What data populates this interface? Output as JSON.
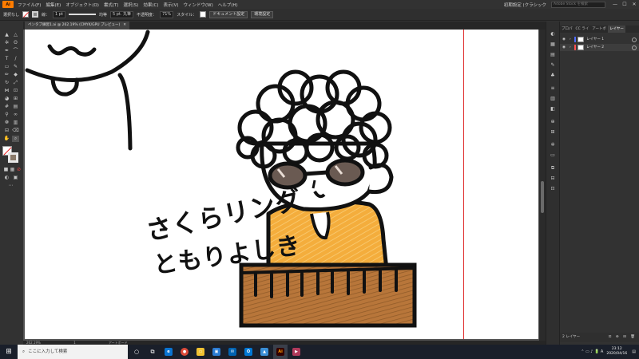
{
  "menubar": {
    "logo": "Ai",
    "items": [
      "ファイル(F)",
      "編集(E)",
      "オブジェクト(O)",
      "書式(T)",
      "選択(S)",
      "効果(C)",
      "表示(V)",
      "ウィンドウ(W)",
      "ヘルプ(H)"
    ],
    "workspace": "初期設定 (クラシック",
    "search_placeholder": "Adobe Stock を検索",
    "window_controls": [
      "—",
      "☐",
      "✕"
    ]
  },
  "controlbar": {
    "selection": "選択なし",
    "stroke_label": "線：",
    "stroke_weight": "1 pt",
    "line_style": "均等",
    "brush": "5 pt. 丸筆",
    "opacity_label": "不透明度：",
    "opacity_value": "71%",
    "style_label": "スタイル：",
    "doc_settings": "ドキュメント設定",
    "env_settings": "環境設定"
  },
  "document": {
    "tab_title": "ペンタブ練習1.ai @ 262.19% (CMYK/GPU プレビュー)",
    "tab_close": "✕"
  },
  "artwork": {
    "line1": "さくらリング",
    "line2": "ともりよしき"
  },
  "status": {
    "zoom": "262.19%",
    "page": "1",
    "tool": "アートボード"
  },
  "layers_panel": {
    "tabs": [
      "プロパ",
      "CC ライ",
      "アートボ",
      "レイヤー"
    ],
    "active_tab": "レイヤー",
    "layers": [
      {
        "name": "レイヤー 1",
        "color": "#4f6bff"
      },
      {
        "name": "レイヤー 2",
        "color": "#ff4f4f"
      }
    ],
    "footer_label": "2 レイヤー"
  },
  "taskbar": {
    "search_placeholder": "ここに入力して検索",
    "time": "23:12",
    "date": "2020/04/16"
  },
  "colors": {
    "accent": "#ff7c00",
    "shirt": "#f4ad3c",
    "piano": "#b8763a"
  }
}
